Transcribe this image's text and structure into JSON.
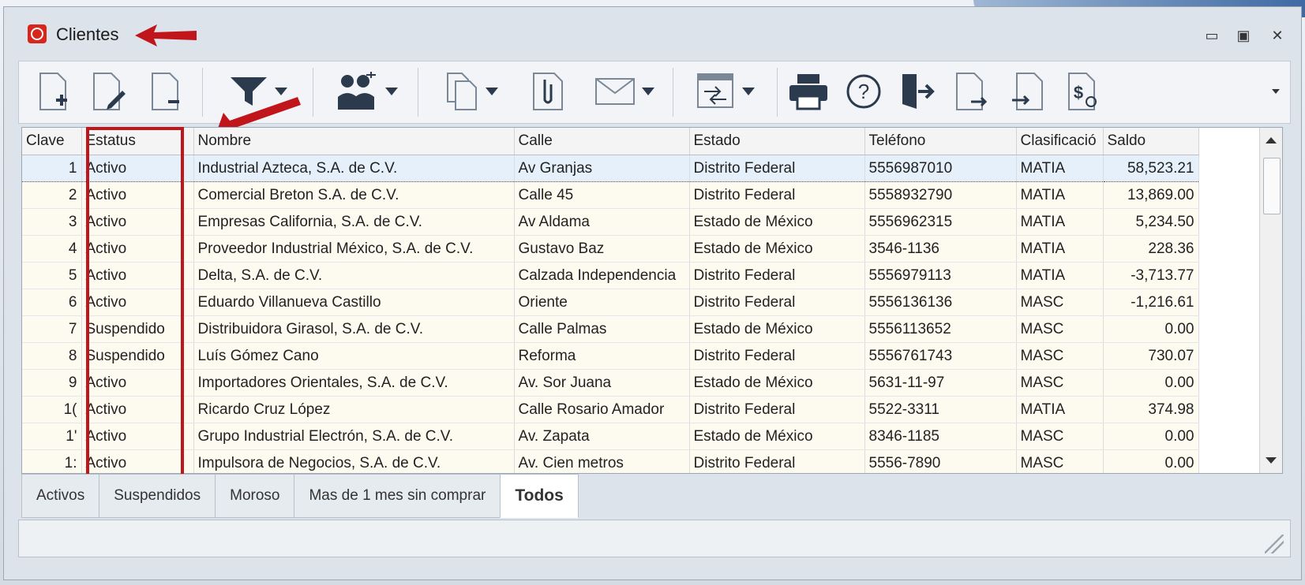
{
  "window": {
    "title": "Clientes"
  },
  "grid": {
    "columns": [
      "Clave",
      "Estatus",
      "Nombre",
      "Calle",
      "Estado",
      "Teléfono",
      "Clasificació",
      "Saldo"
    ],
    "rows": [
      {
        "clave": "1",
        "estatus": "Activo",
        "nombre": "Industrial Azteca, S.A. de C.V.",
        "calle": "Av Granjas",
        "estado": "Distrito Federal",
        "telefono": "5556987010",
        "clasificacion": "MATIA",
        "saldo": "58,523.21"
      },
      {
        "clave": "2",
        "estatus": "Activo",
        "nombre": "Comercial Breton S.A. de C.V.",
        "calle": "Calle 45",
        "estado": "Distrito Federal",
        "telefono": "5558932790",
        "clasificacion": "MATIA",
        "saldo": "13,869.00"
      },
      {
        "clave": "3",
        "estatus": "Activo",
        "nombre": "Empresas California, S.A. de C.V.",
        "calle": "Av Aldama",
        "estado": "Estado de México",
        "telefono": "5556962315",
        "clasificacion": "MATIA",
        "saldo": "5,234.50"
      },
      {
        "clave": "4",
        "estatus": "Activo",
        "nombre": "Proveedor Industrial México, S.A. de C.V.",
        "calle": "Gustavo Baz",
        "estado": "Estado de México",
        "telefono": "3546-1136",
        "clasificacion": "MATIA",
        "saldo": "228.36"
      },
      {
        "clave": "5",
        "estatus": "Activo",
        "nombre": "Delta, S.A. de C.V.",
        "calle": "Calzada Independencia",
        "estado": "Distrito Federal",
        "telefono": "5556979113",
        "clasificacion": "MATIA",
        "saldo": "-3,713.77"
      },
      {
        "clave": "6",
        "estatus": "Activo",
        "nombre": "Eduardo Villanueva Castillo",
        "calle": "Oriente",
        "estado": "Distrito Federal",
        "telefono": "5556136136",
        "clasificacion": "MASC",
        "saldo": "-1,216.61"
      },
      {
        "clave": "7",
        "estatus": "Suspendido",
        "nombre": "Distribuidora Girasol, S.A. de C.V.",
        "calle": "Calle Palmas",
        "estado": "Estado de México",
        "telefono": "5556113652",
        "clasificacion": "MASC",
        "saldo": "0.00"
      },
      {
        "clave": "8",
        "estatus": "Suspendido",
        "nombre": "Luís Gómez Cano",
        "calle": "Reforma",
        "estado": "Distrito Federal",
        "telefono": "5556761743",
        "clasificacion": "MASC",
        "saldo": "730.07"
      },
      {
        "clave": "9",
        "estatus": "Activo",
        "nombre": "Importadores Orientales, S.A. de C.V.",
        "calle": "Av. Sor Juana",
        "estado": "Estado de México",
        "telefono": "5631-11-97",
        "clasificacion": "MASC",
        "saldo": "0.00"
      },
      {
        "clave": "1(",
        "estatus": "Activo",
        "nombre": "Ricardo Cruz López",
        "calle": "Calle Rosario Amador",
        "estado": "Distrito Federal",
        "telefono": "5522-3311",
        "clasificacion": "MATIA",
        "saldo": "374.98"
      },
      {
        "clave": "1'",
        "estatus": "Activo",
        "nombre": "Grupo Industrial Electrón, S.A. de C.V.",
        "calle": "Av. Zapata",
        "estado": "Estado de México",
        "telefono": "8346-1185",
        "clasificacion": "MASC",
        "saldo": "0.00"
      },
      {
        "clave": "1:",
        "estatus": "Activo",
        "nombre": "Impulsora de Negocios, S.A. de C.V.",
        "calle": "Av. Cien metros",
        "estado": "Distrito Federal",
        "telefono": "5556-7890",
        "clasificacion": "MASC",
        "saldo": "0.00"
      }
    ]
  },
  "tabs": [
    {
      "label": "Activos",
      "active": false
    },
    {
      "label": "Suspendidos",
      "active": false
    },
    {
      "label": "Moroso",
      "active": false
    },
    {
      "label": "Mas de 1 mes sin comprar",
      "active": false
    },
    {
      "label": "Todos",
      "active": true
    }
  ],
  "toolbar": {
    "icons": [
      "new-document-icon",
      "edit-document-icon",
      "delete-document-icon",
      "filter-icon",
      "users-icon",
      "copy-icon",
      "attach-icon",
      "email-icon",
      "window-transfer-icon",
      "print-icon",
      "help-icon",
      "exit-icon",
      "export-icon",
      "import-icon",
      "invoice-icon"
    ]
  },
  "colors": {
    "annotation": "#c0151b",
    "app_icon": "#d9261c",
    "selected_row": "#e6f0fb"
  }
}
